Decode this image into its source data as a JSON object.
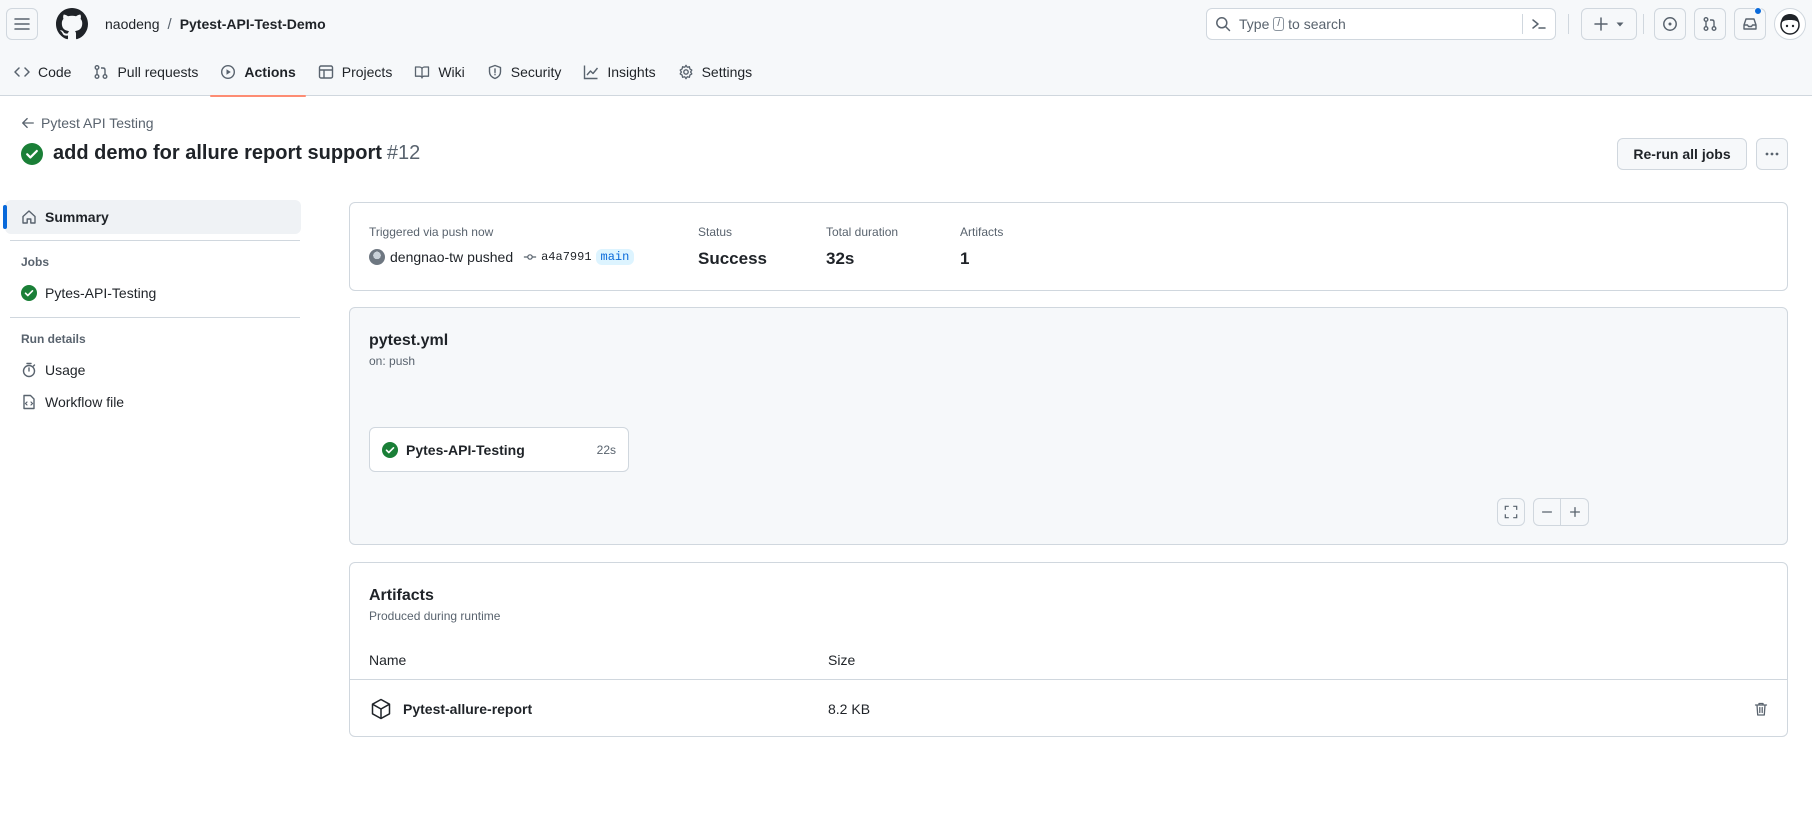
{
  "header": {
    "owner": "naodeng",
    "separator": "/",
    "repo": "Pytest-API-Test-Demo",
    "search": {
      "prefix": "Type",
      "key": "/",
      "suffix": "to search"
    },
    "accent_color": "#0969da"
  },
  "tabs": [
    {
      "label": "Code",
      "icon": "code-icon"
    },
    {
      "label": "Pull requests",
      "icon": "git-pull-request-icon"
    },
    {
      "label": "Actions",
      "icon": "play-icon",
      "active": true
    },
    {
      "label": "Projects",
      "icon": "table-icon"
    },
    {
      "label": "Wiki",
      "icon": "book-icon"
    },
    {
      "label": "Security",
      "icon": "shield-icon"
    },
    {
      "label": "Insights",
      "icon": "graph-icon"
    },
    {
      "label": "Settings",
      "icon": "gear-icon"
    }
  ],
  "run": {
    "back_label": "Pytest API Testing",
    "title": "add demo for allure report support",
    "number": "#12",
    "rerun_label": "Re-run all jobs",
    "status_color": "#1a7f37"
  },
  "sidebar": {
    "summary_label": "Summary",
    "jobs_heading": "Jobs",
    "jobs": [
      {
        "label": "Pytes-API-Testing"
      }
    ],
    "details_heading": "Run details",
    "details": [
      {
        "label": "Usage",
        "icon": "stopwatch-icon"
      },
      {
        "label": "Workflow file",
        "icon": "file-icon"
      }
    ]
  },
  "summary": {
    "triggered_label": "Triggered via push now",
    "actor": "dengnao-tw",
    "action": "pushed",
    "commit": "a4a7991",
    "branch": "main",
    "status_label": "Status",
    "status_value": "Success",
    "duration_label": "Total duration",
    "duration_value": "32s",
    "artifacts_label": "Artifacts",
    "artifacts_value": "1"
  },
  "workflow": {
    "file": "pytest.yml",
    "trigger": "on: push",
    "job": {
      "name": "Pytes-API-Testing",
      "duration": "22s"
    }
  },
  "artifacts": {
    "title": "Artifacts",
    "subtitle": "Produced during runtime",
    "columns": [
      "Name",
      "Size"
    ],
    "rows": [
      {
        "name": "Pytest-allure-report",
        "size": "8.2 KB"
      }
    ]
  }
}
